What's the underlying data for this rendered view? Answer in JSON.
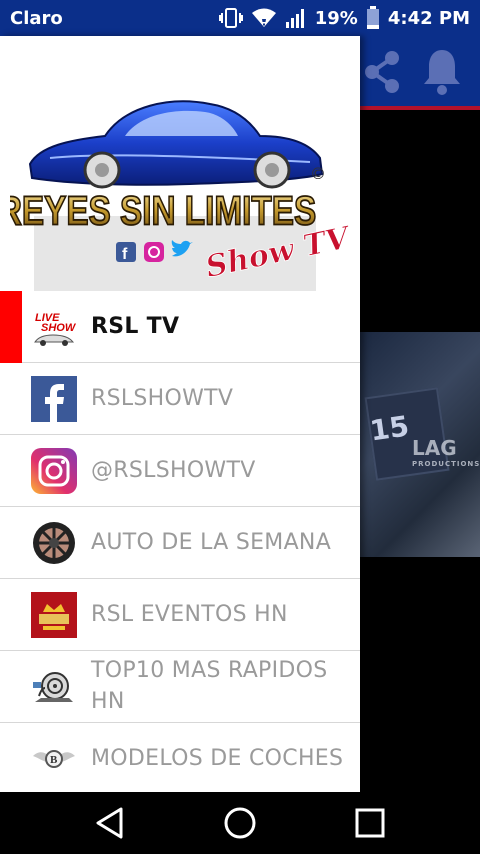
{
  "status_bar": {
    "carrier": "Claro",
    "battery": "19%",
    "time": "4:42 PM",
    "icons": [
      "vibrate-icon",
      "wifi-icon",
      "signal-icon",
      "battery-icon"
    ]
  },
  "header": {
    "logo_text_line1": "REYES SIN LIMITES",
    "logo_text_line2": "Show TV",
    "logo_registered": "©"
  },
  "background_app": {
    "toolbar_icons": [
      "share-icon",
      "bell-icon"
    ],
    "video_number": "15",
    "video_watermark": "LAG",
    "video_watermark_sub": "PRODUCTIONS"
  },
  "menu": {
    "items": [
      {
        "label": "RSL TV",
        "icon": "live-show-icon",
        "active": true
      },
      {
        "label": "RSLSHOWTV",
        "icon": "facebook-icon",
        "active": false
      },
      {
        "label": "@RSLSHOWTV",
        "icon": "instagram-icon",
        "active": false
      },
      {
        "label": "AUTO DE LA SEMANA",
        "icon": "wheel-icon",
        "active": false
      },
      {
        "label": "RSL EVENTOS HN",
        "icon": "crown-badge-icon",
        "active": false
      },
      {
        "label": "TOP10 MAS RAPIDOS HN",
        "icon": "turbo-snail-icon",
        "active": false
      },
      {
        "label": "MODELOS DE COCHES",
        "icon": "bentley-logo-icon",
        "active": false
      }
    ]
  },
  "colors": {
    "primary": "#0b2f8a",
    "accent": "#ff0000",
    "toolbar_divider": "#b3122a"
  }
}
